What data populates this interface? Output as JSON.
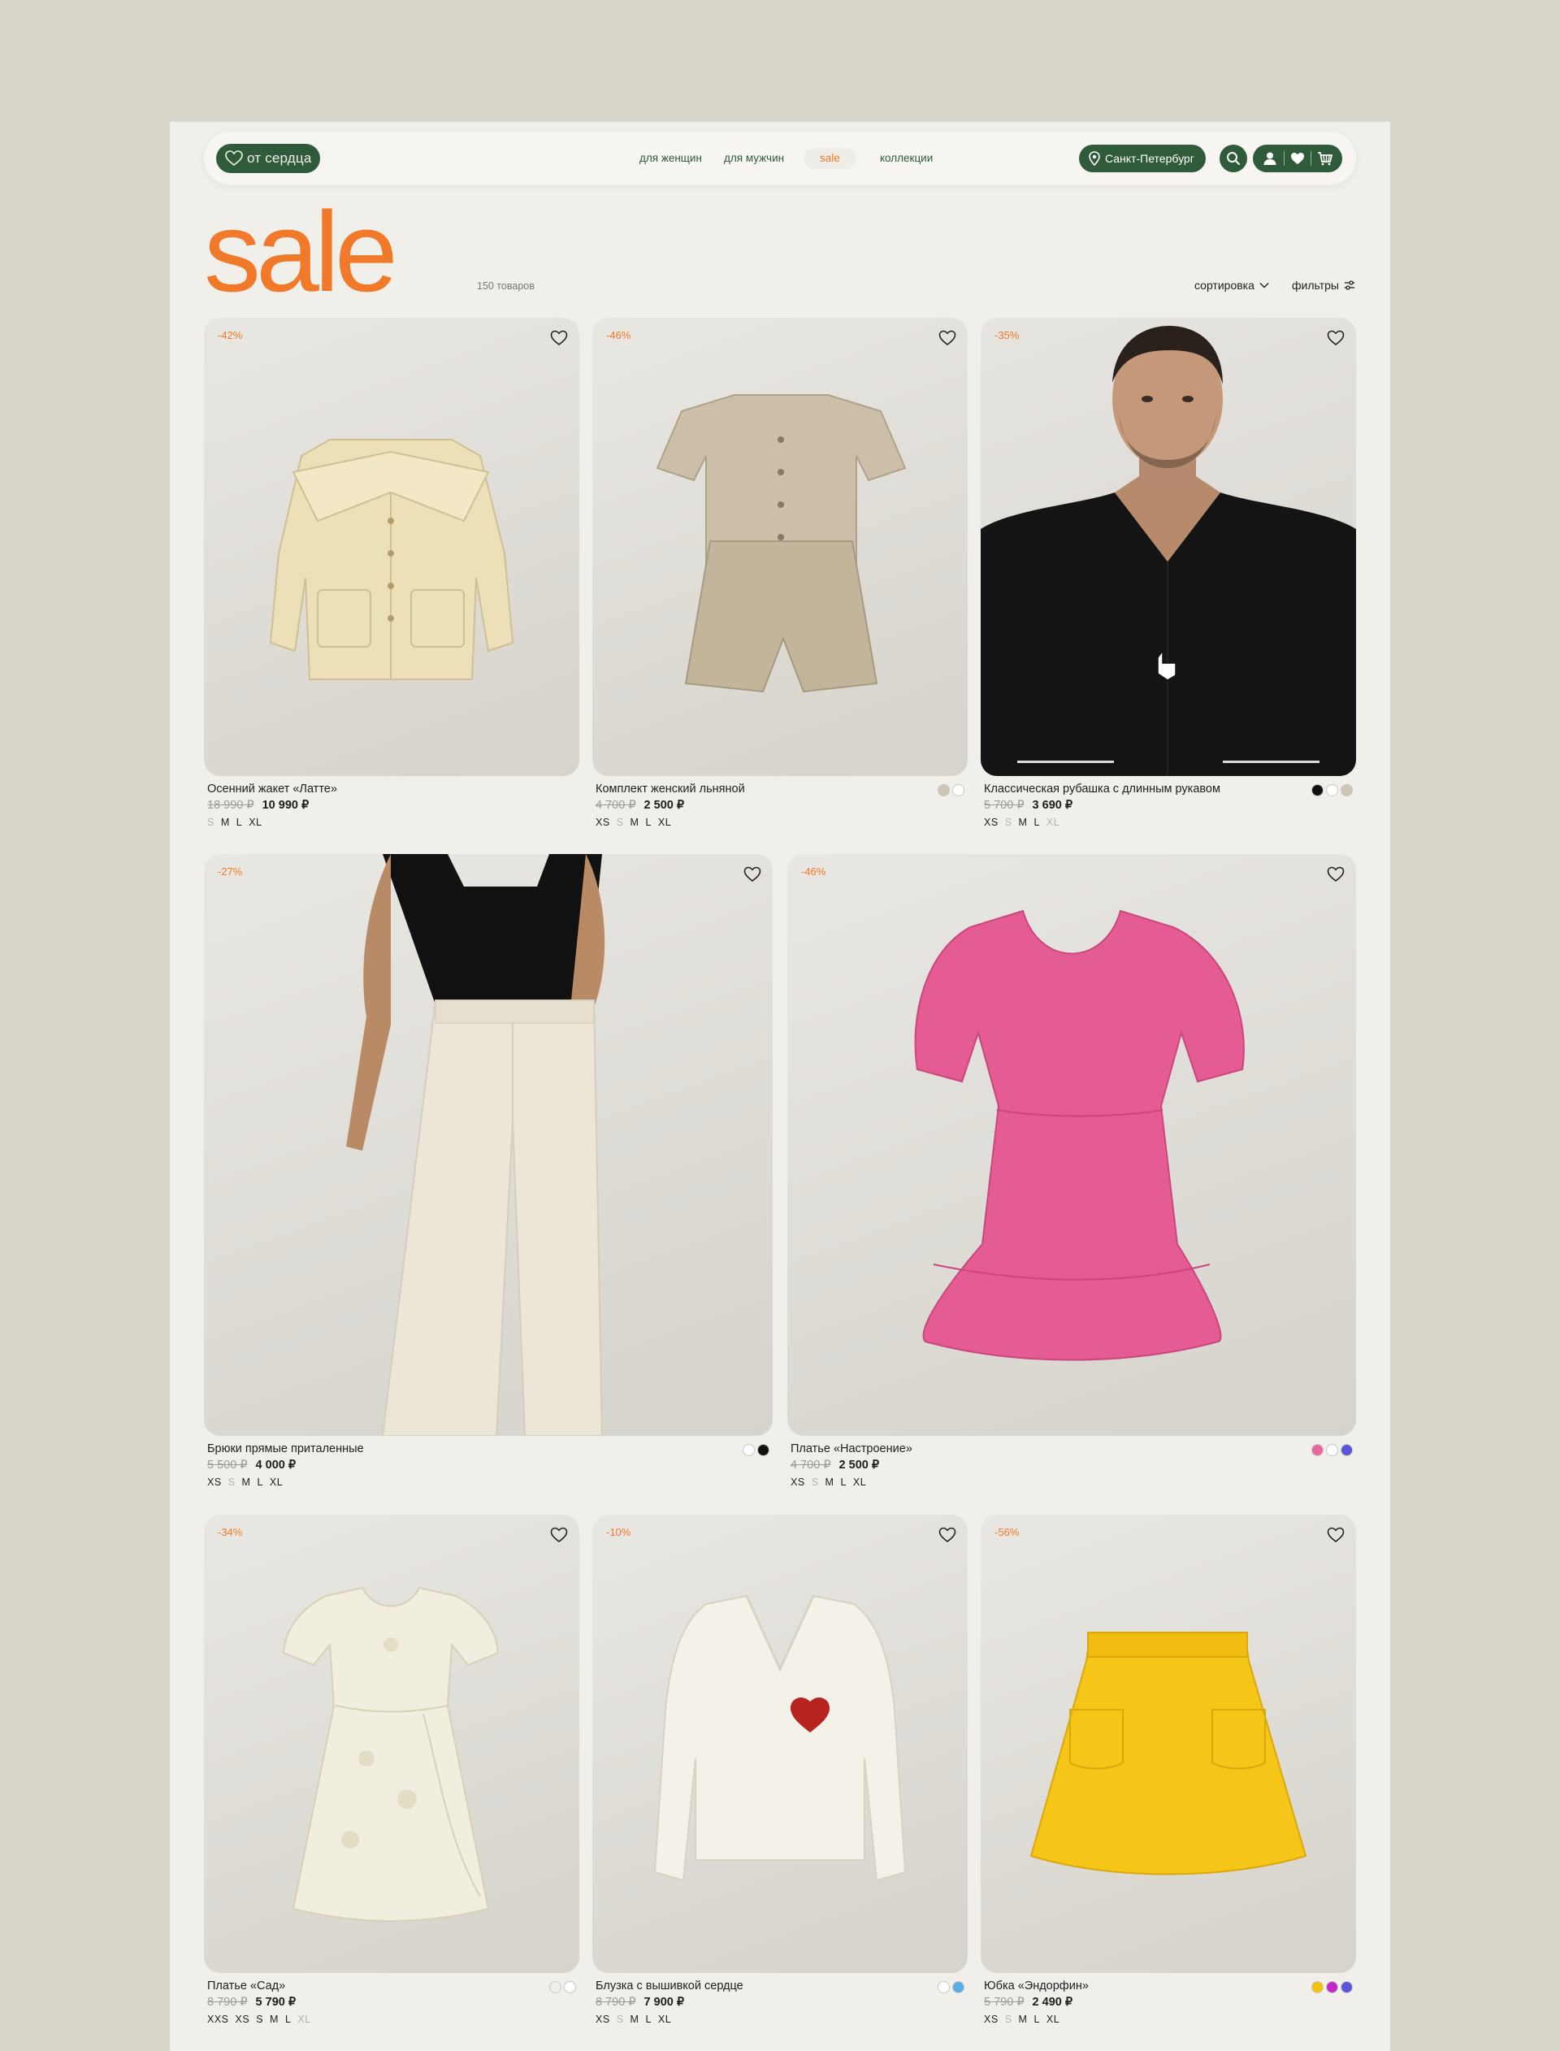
{
  "header": {
    "logo": "от сердца",
    "nav": [
      {
        "label": "для женщин"
      },
      {
        "label": "для мужчин"
      },
      {
        "label": "sale"
      },
      {
        "label": "коллекции"
      }
    ],
    "city": "Санкт-Петербург",
    "icons": [
      "search-icon",
      "user-icon",
      "heart-icon",
      "cart-icon"
    ]
  },
  "page": {
    "title": "sale",
    "count": "150 товаров",
    "sort_label": "сортировка",
    "filters_label": "фильтры"
  },
  "colors": {
    "accent": "#f0792a",
    "brand_green": "#2f5b3a",
    "page_bg": "#f1efea",
    "outer_bg": "#d8d5ca"
  },
  "products": [
    {
      "discount": "-42%",
      "name": "Осенний жакет «Латте»",
      "old_price": "18 990 ₽",
      "price": "10 990 ₽",
      "sizes": [
        {
          "s": "S",
          "a": false
        },
        {
          "s": "M",
          "a": true
        },
        {
          "s": "L",
          "a": true
        },
        {
          "s": "XL",
          "a": true
        }
      ],
      "swatches": []
    },
    {
      "discount": "-46%",
      "name": "Комплект женский льняной",
      "old_price": "4 700 ₽",
      "price": "2 500 ₽",
      "sizes": [
        {
          "s": "XS",
          "a": true
        },
        {
          "s": "S",
          "a": false
        },
        {
          "s": "M",
          "a": true
        },
        {
          "s": "L",
          "a": true
        },
        {
          "s": "XL",
          "a": true
        }
      ],
      "swatches": [
        "#cfc6b4",
        "#ffffff"
      ]
    },
    {
      "discount": "-35%",
      "name": "Классическая рубашка с длинным рукавом",
      "old_price": "5 700 ₽",
      "price": "3 690 ₽",
      "sizes": [
        {
          "s": "XS",
          "a": true
        },
        {
          "s": "S",
          "a": false
        },
        {
          "s": "M",
          "a": true
        },
        {
          "s": "L",
          "a": true
        },
        {
          "s": "XL",
          "a": false
        }
      ],
      "swatches": [
        "#111111",
        "#ffffff",
        "#cfc6b4"
      ]
    },
    {
      "discount": "-27%",
      "name": "Брюки прямые приталенные",
      "old_price": "5 500 ₽",
      "price": "4 000 ₽",
      "sizes": [
        {
          "s": "XS",
          "a": true
        },
        {
          "s": "S",
          "a": false
        },
        {
          "s": "M",
          "a": true
        },
        {
          "s": "L",
          "a": true
        },
        {
          "s": "XL",
          "a": true
        }
      ],
      "swatches": [
        "#ffffff",
        "#111111"
      ]
    },
    {
      "discount": "-46%",
      "name": "Платье «Настроение»",
      "old_price": "4 700 ₽",
      "price": "2 500 ₽",
      "sizes": [
        {
          "s": "XS",
          "a": true
        },
        {
          "s": "S",
          "a": false
        },
        {
          "s": "M",
          "a": true
        },
        {
          "s": "L",
          "a": true
        },
        {
          "s": "XL",
          "a": true
        }
      ],
      "swatches": [
        "#e9669e",
        "#ffffff",
        "#5b55d8"
      ]
    },
    {
      "discount": "-34%",
      "name": "Платье «Сад»",
      "old_price": "8 790 ₽",
      "price": "5 790 ₽",
      "sizes": [
        {
          "s": "XXS",
          "a": true
        },
        {
          "s": "XS",
          "a": true
        },
        {
          "s": "S",
          "a": true
        },
        {
          "s": "M",
          "a": true
        },
        {
          "s": "L",
          "a": true
        },
        {
          "s": "XL",
          "a": false
        }
      ],
      "swatches": [
        "#efeee9",
        "#ffffff"
      ]
    },
    {
      "discount": "-10%",
      "name": "Блузка с вышивкой сердце",
      "old_price": "8 790 ₽",
      "price": "7 900 ₽",
      "sizes": [
        {
          "s": "XS",
          "a": true
        },
        {
          "s": "S",
          "a": false
        },
        {
          "s": "M",
          "a": true
        },
        {
          "s": "L",
          "a": true
        },
        {
          "s": "XL",
          "a": true
        }
      ],
      "swatches": [
        "#ffffff",
        "#5aaee6"
      ]
    },
    {
      "discount": "-56%",
      "name": "Юбка «Эндорфин»",
      "old_price": "5 790 ₽",
      "price": "2 490 ₽",
      "sizes": [
        {
          "s": "XS",
          "a": true
        },
        {
          "s": "S",
          "a": false
        },
        {
          "s": "M",
          "a": true
        },
        {
          "s": "L",
          "a": true
        },
        {
          "s": "XL",
          "a": true
        }
      ],
      "swatches": [
        "#f4c20d",
        "#c128c7",
        "#5b55d8"
      ]
    }
  ]
}
